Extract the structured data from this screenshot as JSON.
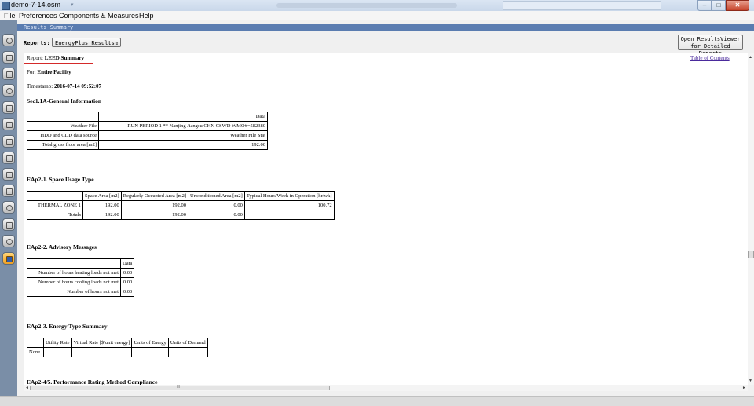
{
  "window": {
    "title": "demo-7-14.osm",
    "min_glyph": "–",
    "max_glyph": "□",
    "close_glyph": "✕"
  },
  "menu": {
    "file": "File",
    "preferences": "Preferences",
    "components": "Components & Measures",
    "help": "Help"
  },
  "panel": {
    "header": "Results Summary"
  },
  "toolbar": {
    "reports_label": "Reports:",
    "reports_selected": "EnergyPlus Results",
    "open_viewer_line1": "Open ResultsViewer",
    "open_viewer_line2": "for Detailed Reports"
  },
  "report": {
    "toc_link": "Table of Contents",
    "report_prefix": "Report:",
    "report_name": "LEED Summary",
    "for_prefix": "For:",
    "for_value": "Entire Facility",
    "timestamp_prefix": "Timestamp:",
    "timestamp_value": "2016-07-14 09:52:07",
    "sec1": {
      "title": "Sec1.1A-General Information",
      "col": "Data",
      "rows": [
        {
          "label": "Weather File",
          "value": "RUN PERIOD 1 ** Nanjing Jiangsu CHN CSWD WMO#=582380"
        },
        {
          "label": "HDD and CDD data source",
          "value": "Weather File Stat"
        },
        {
          "label": "Total gross floor area [m2]",
          "value": "192.00"
        }
      ]
    },
    "eap21": {
      "title": "EAp2-1. Space Usage Type",
      "cols": [
        "Space Area [m2]",
        "Regularly Occupied Area [m2]",
        "Unconditioned Area [m2]",
        "Typical Hours/Week in Operation [hr/wk]"
      ],
      "rows": [
        {
          "label": "THERMAL ZONE 1",
          "values": [
            "192.00",
            "192.00",
            "0.00",
            "100.72"
          ]
        },
        {
          "label": "Totals",
          "values": [
            "192.00",
            "192.00",
            "0.00",
            ""
          ]
        }
      ]
    },
    "eap22": {
      "title": "EAp2-2. Advisory Messages",
      "col": "Data",
      "rows": [
        {
          "label": "Number of hours heating loads not met",
          "value": "0.00"
        },
        {
          "label": "Number of hours cooling loads not met",
          "value": "0.00"
        },
        {
          "label": "Number of hours not met",
          "value": "0.00"
        }
      ]
    },
    "eap23": {
      "title": "EAp2-3. Energy Type Summary",
      "cols": [
        "Utility Rate",
        "Virtual Rate [$/unit energy]",
        "Units of Energy",
        "Units of Demand"
      ],
      "rows": [
        {
          "label": "None"
        }
      ]
    },
    "eap245": {
      "title": "EAp2-4/5. Performance Rating Method Compliance"
    }
  },
  "scroll": {
    "up": "▲",
    "down": "▼",
    "left": "◄",
    "right": "►",
    "grip": "III"
  }
}
